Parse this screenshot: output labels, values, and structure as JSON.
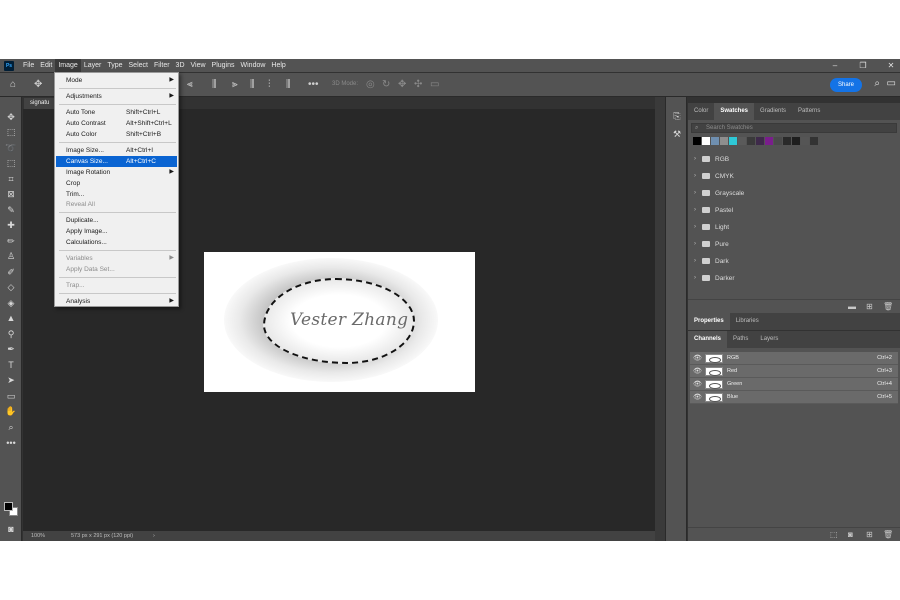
{
  "app": {
    "logo": "Ps"
  },
  "menubar": {
    "items": [
      "File",
      "Edit",
      "Image",
      "Layer",
      "Type",
      "Select",
      "Filter",
      "3D",
      "View",
      "Plugins",
      "Window",
      "Help"
    ],
    "active": "Image"
  },
  "optbar": {
    "mode_3d": "3D Mode:",
    "share_label": "Share"
  },
  "document": {
    "tab_title": "signatu",
    "signature_text": "Vester Zhang"
  },
  "statusbar": {
    "zoom": "100%",
    "dimensions": "573 px x 291 px (120 ppi)",
    "arrow": "›"
  },
  "swatches_panel": {
    "tabs": [
      "Color",
      "Swatches",
      "Gradients",
      "Patterns"
    ],
    "active_tab": "Swatches",
    "search_placeholder": "Search Swatches",
    "recent_colors": [
      "#000000",
      "#ffffff",
      "#6f8fb0",
      "#8e8e8e",
      "#2ec8d6",
      "#5a5a5a",
      "#3a3a3a",
      "#3e2a4a",
      "#7a1e8c",
      "#4a4a4a",
      "#2a2a2a",
      "#1e1e1e",
      "#555555",
      "#333333"
    ],
    "folders": [
      "RGB",
      "CMYK",
      "Grayscale",
      "Pastel",
      "Light",
      "Pure",
      "Dark",
      "Darker"
    ]
  },
  "properties_panel": {
    "tabs": [
      "Properties",
      "Libraries"
    ],
    "active_tab": "Properties"
  },
  "channels_panel": {
    "tabs": [
      "Channels",
      "Paths",
      "Layers"
    ],
    "active_tab": "Channels",
    "rows": [
      {
        "name": "RGB",
        "shortcut": "Ctrl+2"
      },
      {
        "name": "Red",
        "shortcut": "Ctrl+3"
      },
      {
        "name": "Green",
        "shortcut": "Ctrl+4"
      },
      {
        "name": "Blue",
        "shortcut": "Ctrl+5"
      }
    ]
  },
  "image_menu": {
    "items": [
      {
        "label": "Mode",
        "shortcut": "",
        "submenu": true,
        "disabled": false
      },
      {
        "label": "Adjustments",
        "shortcut": "",
        "submenu": true,
        "disabled": false
      },
      {
        "label": "Auto Tone",
        "shortcut": "Shift+Ctrl+L",
        "submenu": false,
        "disabled": false
      },
      {
        "label": "Auto Contrast",
        "shortcut": "Alt+Shift+Ctrl+L",
        "submenu": false,
        "disabled": false
      },
      {
        "label": "Auto Color",
        "shortcut": "Shift+Ctrl+B",
        "submenu": false,
        "disabled": false
      },
      {
        "label": "Image Size...",
        "shortcut": "Alt+Ctrl+I",
        "submenu": false,
        "disabled": false
      },
      {
        "label": "Canvas Size...",
        "shortcut": "Alt+Ctrl+C",
        "submenu": false,
        "disabled": false,
        "selected": true
      },
      {
        "label": "Image Rotation",
        "shortcut": "",
        "submenu": true,
        "disabled": false
      },
      {
        "label": "Crop",
        "shortcut": "",
        "submenu": false,
        "disabled": false
      },
      {
        "label": "Trim...",
        "shortcut": "",
        "submenu": false,
        "disabled": false
      },
      {
        "label": "Reveal All",
        "shortcut": "",
        "submenu": false,
        "disabled": true
      },
      {
        "label": "Duplicate...",
        "shortcut": "",
        "submenu": false,
        "disabled": false
      },
      {
        "label": "Apply Image...",
        "shortcut": "",
        "submenu": false,
        "disabled": false
      },
      {
        "label": "Calculations...",
        "shortcut": "",
        "submenu": false,
        "disabled": false
      },
      {
        "label": "Variables",
        "shortcut": "",
        "submenu": true,
        "disabled": true
      },
      {
        "label": "Apply Data Set...",
        "shortcut": "",
        "submenu": false,
        "disabled": true
      },
      {
        "label": "Trap...",
        "shortcut": "",
        "submenu": false,
        "disabled": true
      },
      {
        "label": "Analysis",
        "shortcut": "",
        "submenu": true,
        "disabled": false
      }
    ]
  }
}
